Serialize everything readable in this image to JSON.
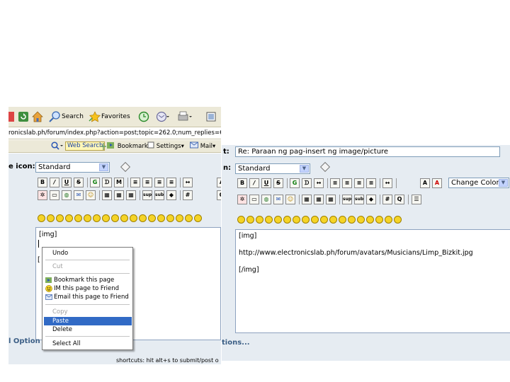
{
  "left": {
    "toolbar": {
      "search_label": "Search",
      "favorites_label": "Favorites"
    },
    "address": "ronicslab.ph/forum/index.php?action=post;topic=262.0;num_replies=6",
    "yahoo": {
      "web_search": "Web Search",
      "bookmarks": "Bookmarks",
      "settings": "Settings",
      "mail": "Mail"
    },
    "message_icon_label": "e icon:",
    "message_icon_value": "Standard",
    "editor_text": {
      "line1": "[img]",
      "line2": "["
    },
    "context_menu": {
      "undo": "Undo",
      "cut": "Cut",
      "bookmark": "Bookmark this page",
      "im": "IM this page to Friend",
      "email": "Email this page to Friend",
      "copy": "Copy",
      "paste": "Paste",
      "delete": "Delete",
      "select_all": "Select All"
    },
    "options_link": "l Option",
    "shortcuts": "shortcuts: hit alt+s to submit/post o"
  },
  "right": {
    "subject_label": "t:",
    "subject_value": "Re: Paraan ng pag-insert ng image/picture",
    "message_icon_label": "n:",
    "message_icon_value": "Standard",
    "change_color": "Change Color",
    "editor_text": {
      "line1": "[img]",
      "line2": "http://www.electronicslab.ph/forum/avatars/Musicians/Limp_Bizkit.jpg",
      "line3": "[/img]"
    },
    "options_link": "tions..."
  }
}
